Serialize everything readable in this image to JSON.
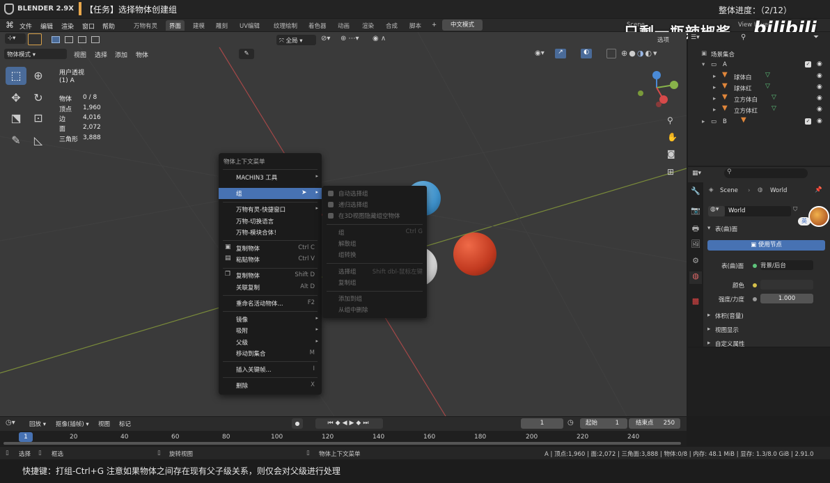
{
  "header": {
    "app_name": "BLENDER 2.9X",
    "task": "【任务】选择物体创建组",
    "progress": "整体进度：（2/12）",
    "watermark": "只剩一瓶辣椒酱",
    "bili_logo": "bilibili"
  },
  "menu": {
    "items": [
      "文件",
      "编辑",
      "渲染",
      "窗口",
      "帮助"
    ],
    "workspaces": [
      "万物有灵",
      "界面",
      "建模",
      "雕刻",
      "UV编辑",
      "纹理绘制",
      "着色器",
      "动画",
      "渲染",
      "合成",
      "脚本"
    ],
    "active_workspace": "界面",
    "add_tab": "+",
    "chinese_btn": "中文模式",
    "scene_label": "Scene",
    "viewlayer_label": "View Layer"
  },
  "viewport_header": {
    "mode": "物体模式",
    "items": [
      "视图",
      "选择",
      "添加",
      "物体"
    ],
    "transform": "全局",
    "options": "选项"
  },
  "viewport_info": {
    "view_name": "用户透视",
    "collection": "(1) A",
    "stats": [
      {
        "label": "物体",
        "value": "0 / 8"
      },
      {
        "label": "顶点",
        "value": "1,960"
      },
      {
        "label": "边",
        "value": "4,016"
      },
      {
        "label": "面",
        "value": "2,072"
      },
      {
        "label": "三角形",
        "value": "3,888"
      }
    ]
  },
  "context_menu": {
    "title": "物体上下文菜单",
    "items": [
      {
        "label": "MACHIN3 工具",
        "shortcut": "",
        "arrow": true
      },
      {
        "label": "组",
        "shortcut": "",
        "arrow": true,
        "highlight": true
      },
      {
        "label": "万物有灵-快捷窗口",
        "shortcut": "",
        "arrow": true
      },
      {
        "label": "万物-切换语言",
        "shortcut": ""
      },
      {
        "label": "万物-模块合体！",
        "shortcut": ""
      },
      {
        "label": "复制物体",
        "shortcut": "Ctrl C",
        "icon": "copy-icon"
      },
      {
        "label": "粘贴物体",
        "shortcut": "Ctrl V",
        "icon": "paste-icon"
      },
      {
        "label": "复制物体",
        "shortcut": "Shift D",
        "icon": "duplicate-icon"
      },
      {
        "label": "关联复制",
        "shortcut": "Alt D"
      },
      {
        "label": "重命名活动物体...",
        "shortcut": "F2"
      },
      {
        "label": "镜像",
        "shortcut": "",
        "arrow": true
      },
      {
        "label": "吸附",
        "shortcut": "",
        "arrow": true
      },
      {
        "label": "父级",
        "shortcut": "",
        "arrow": true
      },
      {
        "label": "移动到集合",
        "shortcut": "M"
      },
      {
        "label": "插入关键帧...",
        "shortcut": "I"
      },
      {
        "label": "删除",
        "shortcut": "X"
      }
    ]
  },
  "submenu": {
    "items": [
      {
        "label": "自动选择组",
        "shortcut": "",
        "check": true
      },
      {
        "label": "递归选择组",
        "shortcut": "",
        "check": true
      },
      {
        "label": "在3D视图隐藏组空物体",
        "shortcut": "",
        "check": true
      },
      {
        "label": "组",
        "shortcut": "Ctrl G"
      },
      {
        "label": "解散组",
        "shortcut": ""
      },
      {
        "label": "组转换",
        "shortcut": ""
      },
      {
        "label": "选择组",
        "shortcut": "Shift dbl-鼠标左键"
      },
      {
        "label": "复制组",
        "shortcut": ""
      },
      {
        "label": "添加到组",
        "shortcut": ""
      },
      {
        "label": "从组中删除",
        "shortcut": ""
      }
    ]
  },
  "outliner": {
    "root": "场景集合",
    "collection_a": "A",
    "objects": [
      "球体白",
      "球体红",
      "立方体白",
      "立方体红"
    ],
    "collection_b": "B"
  },
  "properties": {
    "scene": "Scene",
    "world": "World",
    "world_field": "World",
    "badge": "英",
    "surface_panel": "表(曲)面",
    "use_nodes": "使用节点",
    "surface_label": "表(曲)面",
    "surface_value": "背景/后台",
    "color_label": "颜色",
    "strength_label": "强度/力度",
    "strength_value": "1.000",
    "panels": [
      "体积(音量)",
      "视图显示",
      "自定义属性"
    ]
  },
  "timeline": {
    "items": [
      "回放",
      "抠像(插帧)",
      "视图",
      "标记"
    ],
    "current_frame": "1",
    "start_label": "起始",
    "start": "1",
    "end_label": "结束点",
    "end": "250",
    "ticks": [
      "1",
      "20",
      "40",
      "60",
      "80",
      "100",
      "120",
      "140",
      "160",
      "180",
      "200",
      "220",
      "240"
    ],
    "playhead_frame": 1
  },
  "statusbar": {
    "select": "选择",
    "box_select": "框选",
    "rotate_view": "旋转视图",
    "context_menu": "物体上下文菜单",
    "info": "A | 顶点:1,960 | 面:2,072 | 三角面:3,888 | 物体:0/8 | 内存: 48.1 MiB | 显存: 1.3/8.0 GiB | 2.91.0"
  },
  "caption": "快捷键：打组-Ctrl+G 注意如果物体之间存在现有父子级关系，则仅会对父级进行处理",
  "colors": {
    "accent": "#4772b3",
    "sphere_red": "#c23a20",
    "sphere_blue": "#3d8fc8",
    "active_tool": "#4a6b99"
  }
}
